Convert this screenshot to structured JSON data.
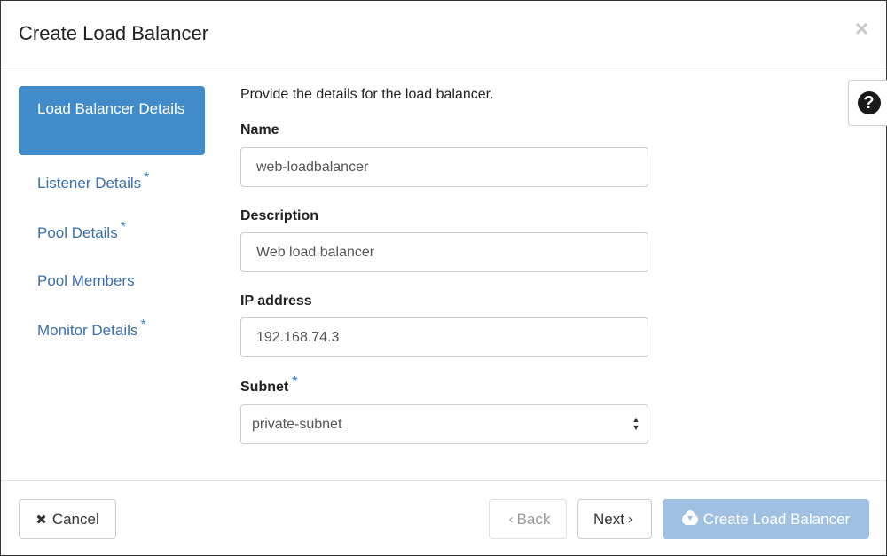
{
  "modal": {
    "title": "Create Load Balancer",
    "close_icon": "×"
  },
  "help": {
    "icon": "?"
  },
  "nav": {
    "items": [
      {
        "label": "Load Balancer Details",
        "required": false,
        "active": true
      },
      {
        "label": "Listener Details",
        "required": true,
        "active": false
      },
      {
        "label": "Pool Details",
        "required": true,
        "active": false
      },
      {
        "label": "Pool Members",
        "required": false,
        "active": false
      },
      {
        "label": "Monitor Details",
        "required": true,
        "active": false
      }
    ],
    "required_mark": "*"
  },
  "form": {
    "intro": "Provide the details for the load balancer.",
    "name": {
      "label": "Name",
      "value": "web-loadbalancer"
    },
    "description": {
      "label": "Description",
      "value": "Web load balancer"
    },
    "ip_address": {
      "label": "IP address",
      "value": "192.168.74.3"
    },
    "subnet": {
      "label": "Subnet",
      "required_mark": "*",
      "value": "private-subnet"
    }
  },
  "footer": {
    "cancel_label": "Cancel",
    "back_label": "Back",
    "next_label": "Next",
    "create_label": "Create Load Balancer"
  },
  "colors": {
    "accent": "#428bca",
    "link": "#3a6fa8",
    "create_disabled": "#a0c0e2"
  }
}
